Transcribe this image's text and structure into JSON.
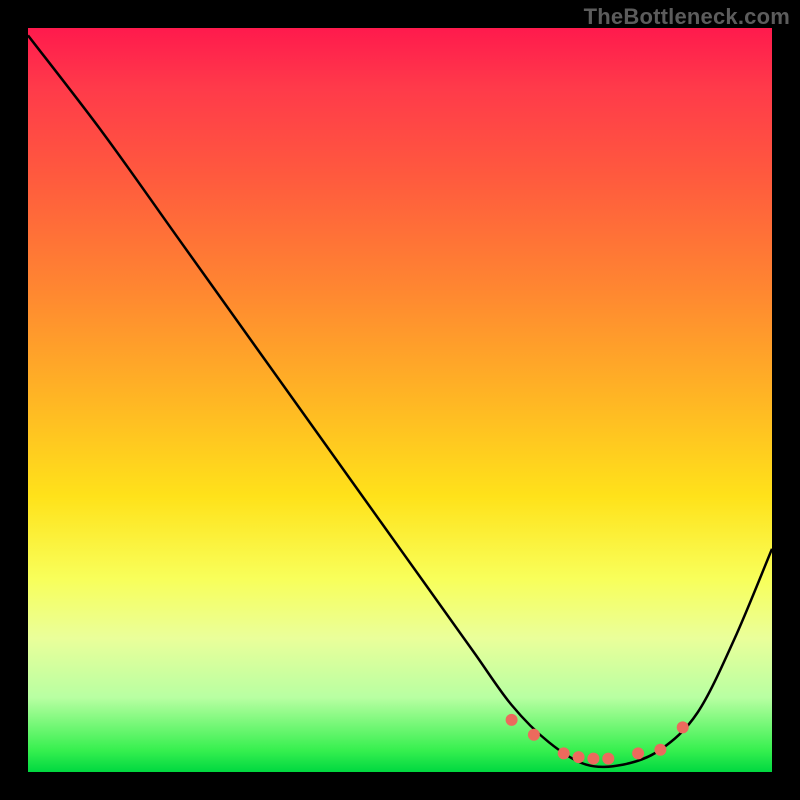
{
  "watermark": "TheBottleneck.com",
  "chart_data": {
    "type": "line",
    "title": "",
    "xlabel": "",
    "ylabel": "",
    "xlim": [
      0,
      100
    ],
    "ylim": [
      0,
      100
    ],
    "grid": false,
    "x": [
      0,
      10,
      20,
      30,
      40,
      50,
      55,
      60,
      65,
      70,
      75,
      80,
      85,
      90,
      95,
      100
    ],
    "values": [
      99,
      86,
      72,
      58,
      44,
      30,
      23,
      16,
      9,
      4,
      1,
      1,
      3,
      8,
      18,
      30
    ],
    "marker_points": {
      "x": [
        65,
        68,
        72,
        74,
        76,
        78,
        82,
        85,
        88
      ],
      "y": [
        7,
        5,
        2.5,
        2,
        1.8,
        1.8,
        2.5,
        3,
        6
      ]
    },
    "colors": {
      "curve": "#000000",
      "markers": "#ec6a5d"
    }
  }
}
